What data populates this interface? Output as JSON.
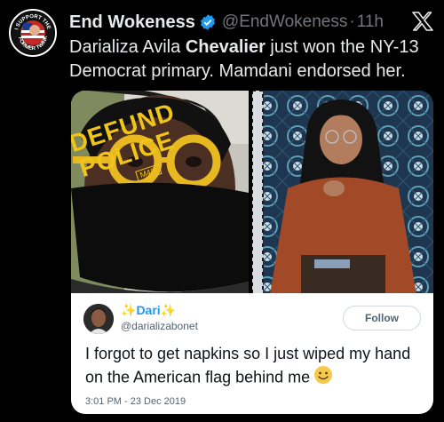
{
  "post": {
    "author_name": "End Wokeness",
    "handle": "@EndWokeness",
    "separator": "·",
    "time": "11h",
    "text_before": "Darializa Avila ",
    "text_bold": "Chevalier",
    "text_after": " just won the NY-13 Democrat primary. Mamdani endorsed her.",
    "avatar_text_top": "I SUPPORT THE",
    "avatar_text_bottom": "FORMER TWINKS"
  },
  "photo_left": {
    "mask_line1": "DEFUND",
    "mask_line2": "POLICE",
    "mask_tag": "M48I"
  },
  "embedded_tweet": {
    "name": "Dari",
    "handle": "@darializabonet",
    "follow_label": "Follow",
    "text": "I forgot to get napkins so I just wiped my hand on the American flag behind me",
    "timestamp": "3:01 PM - 23 Dec 2019"
  },
  "colors": {
    "background": "#000000",
    "verified": "#1d9bf0",
    "link": "#1d9bf0",
    "handle_gray": "#71767b"
  },
  "icons": {
    "verified": "verified-badge-icon",
    "platform": "x-logo-icon",
    "sparkle": "sparkle-icon",
    "emoji": "smiling-face-emoji"
  }
}
